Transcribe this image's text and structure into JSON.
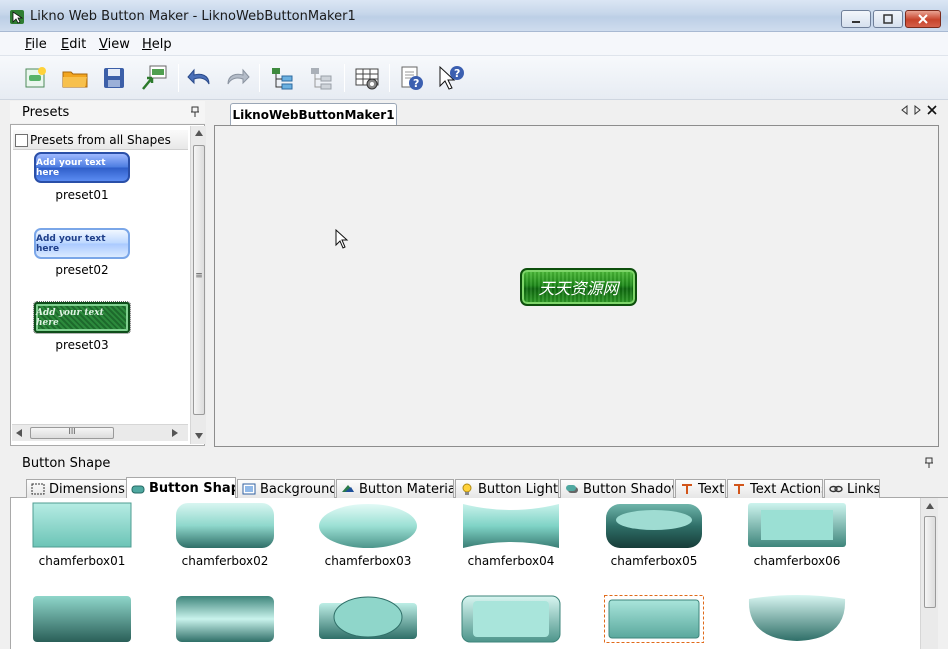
{
  "window": {
    "title": "Likno Web Button Maker - LiknoWebButtonMaker1"
  },
  "menu": [
    {
      "label": "File",
      "accel": "F",
      "rest": "ile"
    },
    {
      "label": "Edit",
      "accel": "E",
      "rest": "dit"
    },
    {
      "label": "View",
      "accel": "V",
      "rest": "iew"
    },
    {
      "label": "Help",
      "accel": "H",
      "rest": "elp"
    }
  ],
  "toolbar": {
    "icons": [
      "new-icon",
      "open-folder-icon",
      "save-icon",
      "export-gif-icon",
      "undo-icon",
      "redo-icon",
      "tree-add-icon",
      "tree-remove-icon",
      "settings-grid-icon",
      "help-icon",
      "whats-this-icon"
    ]
  },
  "presets": {
    "title": "Presets",
    "checkbox_label": "Presets from all Shapes",
    "items": [
      {
        "label": "preset01",
        "button_text": "Add your text here"
      },
      {
        "label": "preset02",
        "button_text": "Add your text here"
      },
      {
        "label": "preset03",
        "button_text": "Add your text here"
      }
    ],
    "scroll_grip": "≡",
    "hscroll_grip": "III"
  },
  "document": {
    "tab_label": "LiknoWebButtonMaker1",
    "canvas_button_text": "天天资源网"
  },
  "shape_panel": {
    "title": "Button Shape",
    "tabs": [
      {
        "label": "Dimensions"
      },
      {
        "label": "Button Shape"
      },
      {
        "label": "Background"
      },
      {
        "label": "Button Material"
      },
      {
        "label": "Button Lights"
      },
      {
        "label": "Button Shadow"
      },
      {
        "label": "Text"
      },
      {
        "label": "Text Actions"
      },
      {
        "label": "Links"
      }
    ],
    "shapes": [
      {
        "label": "chamferbox01"
      },
      {
        "label": "chamferbox02"
      },
      {
        "label": "chamferbox03"
      },
      {
        "label": "chamferbox04"
      },
      {
        "label": "chamferbox05"
      },
      {
        "label": "chamferbox06"
      }
    ]
  },
  "colors": {
    "shape_teal": "#7fd3c6",
    "canvas_button_green": "#1f8c1a",
    "preset_blue": "#4a7be0",
    "selection_orange": "#e06a1a"
  }
}
